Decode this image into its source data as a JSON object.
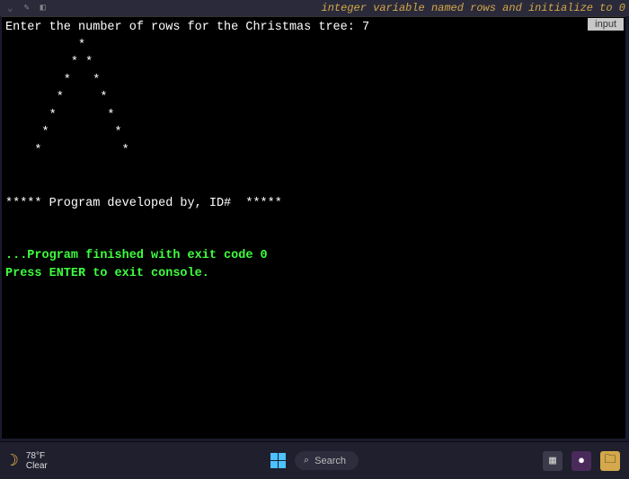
{
  "ide_hint": "integer variable named rows and initialize to 0",
  "input_badge": "input",
  "console": {
    "prompt_line": "Enter the number of rows for the Christmas tree: 7",
    "tree_lines": [
      "          *",
      "         * *",
      "        *   *",
      "       *     *",
      "      *       *",
      "     *         *",
      "    *           *",
      "",
      "",
      "***** Program developed by, ID#  *****",
      "",
      ""
    ],
    "exit_line1": "...Program finished with exit code 0",
    "exit_line2": "Press ENTER to exit console."
  },
  "taskbar": {
    "temp": "78°F",
    "condition": "Clear",
    "search_label": "Search"
  }
}
